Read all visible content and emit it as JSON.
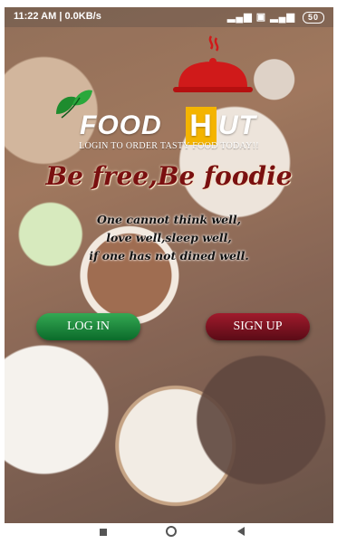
{
  "status_bar": {
    "time": "11:22 AM",
    "speed": "0.0KB/s",
    "icons": "signal-icon wifi-icon signal-icon",
    "battery": "50"
  },
  "logo": {
    "word_food": "FOOD",
    "letter_h": "H",
    "word_ut": "UT",
    "leaf_color": "#1e8c2e",
    "cloche_color": "#d01a1a",
    "h_color": "#f4b400"
  },
  "tagline": "LOGIN TO ORDER TASTY FOOD TODAY!!",
  "headline": "Be free,Be foodie",
  "quote": {
    "line1": "One cannot think well,",
    "line2": "love well,sleep well,",
    "line3": "if one has not dined well."
  },
  "buttons": {
    "login": "LOG IN",
    "signup": "SIGN UP"
  },
  "nav": {
    "icons": [
      "recent-apps-icon",
      "home-icon",
      "back-icon"
    ]
  }
}
